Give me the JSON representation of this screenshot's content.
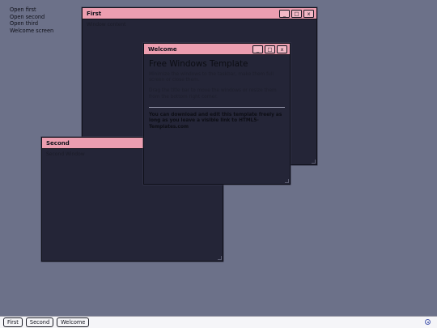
{
  "desktop_links": [
    "Open first",
    "Open second",
    "Open third",
    "Welcome screen"
  ],
  "windows": {
    "first": {
      "title": "First",
      "content": "Window content"
    },
    "second": {
      "title": "Second",
      "content": "Second Window"
    },
    "welcome": {
      "title": "Welcome",
      "heading": "Free Windows Template",
      "para1": "Minimize the windows to the taskbar, make them full screen or close them.",
      "para2": "Drag the title bar to move the windows or resize them from the bottom right corner.",
      "para3": "You can download and edit this template freely as long as you leave a visible link to HTML5-Templates.com"
    }
  },
  "controls": {
    "minimize": "_",
    "maximize": "□",
    "close": "x"
  },
  "taskbar": {
    "items": [
      "First",
      "Second",
      "Welcome"
    ]
  },
  "colors": {
    "desktop": "#6c7189",
    "window_body": "#242537",
    "titlebar": "#ec9eb0",
    "taskbar": "#f5f5f8"
  }
}
